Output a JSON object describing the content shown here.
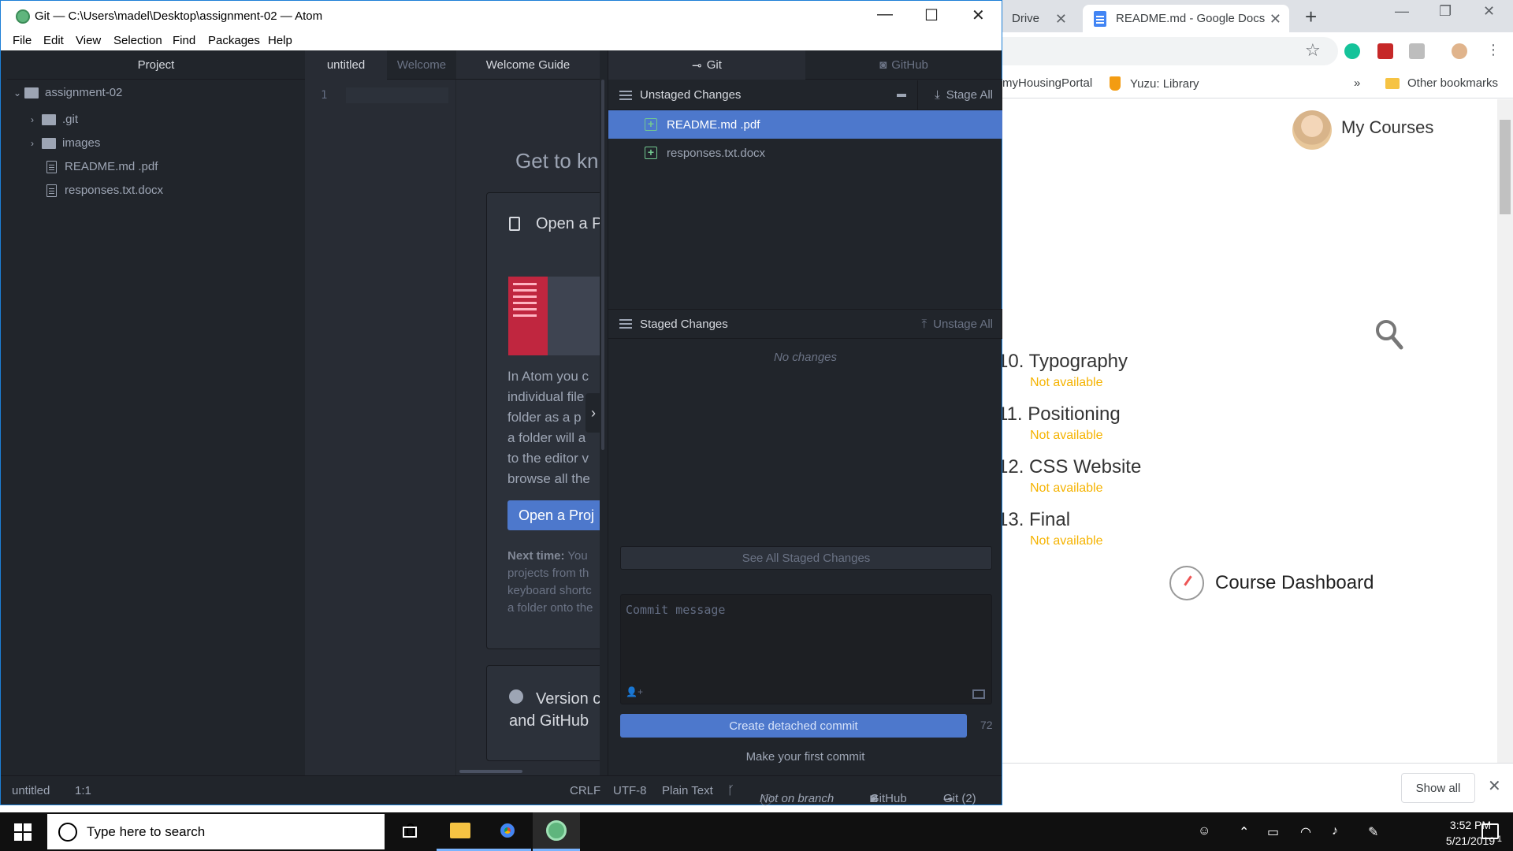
{
  "chrome": {
    "tabs": [
      {
        "label": "Drive"
      },
      {
        "label": "README.md - Google Docs"
      }
    ],
    "bookmarks": [
      {
        "label": "myHousingPortal"
      },
      {
        "label": "Yuzu: Library"
      },
      {
        "label": "»"
      },
      {
        "label": "Other bookmarks"
      }
    ],
    "page": {
      "my_courses": "My Courses",
      "courses": [
        {
          "num": "10.",
          "title": "Typography",
          "status": "Not available"
        },
        {
          "num": "11.",
          "title": "Positioning",
          "status": "Not available"
        },
        {
          "num": "12.",
          "title": "CSS Website",
          "status": "Not available"
        },
        {
          "num": "13.",
          "title": "Final",
          "status": "Not available"
        }
      ],
      "course_dashboard": "Course Dashboard"
    },
    "downloads": {
      "show_all": "Show all"
    }
  },
  "atom": {
    "title": "Git — C:\\Users\\madel\\Desktop\\assignment-02 — Atom",
    "menu": [
      "File",
      "Edit",
      "View",
      "Selection",
      "Find",
      "Packages",
      "Help"
    ],
    "tree": {
      "header": "Project",
      "root": "assignment-02",
      "items": [
        {
          "name": ".git",
          "type": "folder"
        },
        {
          "name": "images",
          "type": "folder"
        },
        {
          "name": "README.md .pdf",
          "type": "pdf"
        },
        {
          "name": "responses.txt.docx",
          "type": "file"
        }
      ]
    },
    "editor_tabs": [
      "untitled",
      "Welcome"
    ],
    "line_number": "1",
    "welcome_guide": {
      "tab": "Welcome Guide",
      "heading": "Get to kn",
      "card1_title": "Open a P",
      "card1_text": "In Atom you c\nindividual file\nfolder as a p\na folder will a\nto the editor v\nbrowse all the",
      "card1_button": "Open a Proj",
      "next_time_label": "Next time:",
      "next_time_text": " You\nprojects from th\nkeyboard shortc\na folder onto the",
      "card2_title": "Version c\nand GitHub"
    },
    "git": {
      "tabs": [
        {
          "label": "Git"
        },
        {
          "label": "GitHub"
        }
      ],
      "unstaged_header": "Unstaged Changes",
      "stage_all": "Stage All",
      "unstaged_files": [
        "README.md .pdf",
        "responses.txt.docx"
      ],
      "staged_header": "Staged Changes",
      "unstage_all": "Unstage All",
      "no_changes": "No changes",
      "see_all": "See All Staged Changes",
      "commit_placeholder": "Commit message",
      "commit_button": "Create detached commit",
      "char_count": "72",
      "first_commit": "Make your first commit"
    },
    "status": {
      "file": "untitled",
      "position": "1:1",
      "line_ending": "CRLF",
      "encoding": "UTF-8",
      "grammar": "Plain Text",
      "branch": "Not on branch",
      "github": "GitHub",
      "git": "Git (2)"
    }
  },
  "taskbar": {
    "search_placeholder": "Type here to search",
    "time": "3:52 PM",
    "date": "5/21/2019",
    "notif_count": "1"
  },
  "colors": {
    "atom_bg": "#21252b",
    "editor_bg": "#282c34",
    "selection_blue": "#4d78cc",
    "not_available": "#f5b301",
    "added_green": "#73c990"
  }
}
